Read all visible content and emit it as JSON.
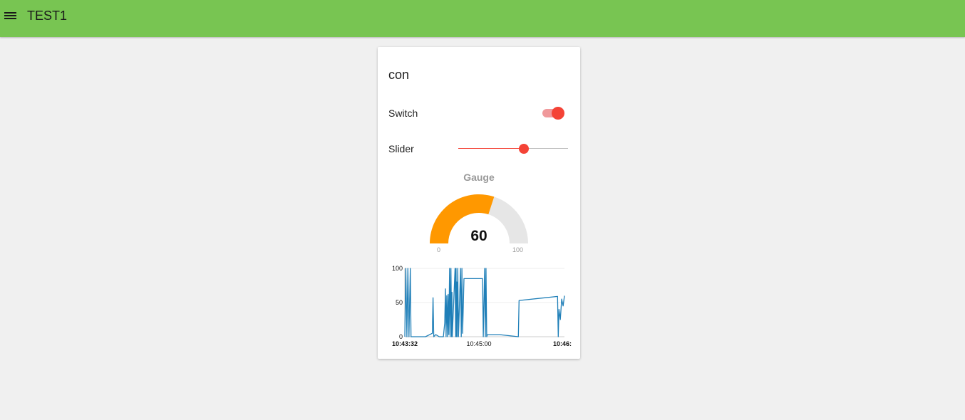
{
  "app": {
    "title": "TEST1"
  },
  "icons": {
    "menu": "menu-icon"
  },
  "colors": {
    "header": "#78c552",
    "accent": "#f44336",
    "gauge_fill": "#ff9800",
    "gauge_track": "#e6e6e6",
    "line": "#1f7fb8"
  },
  "group": {
    "title": "con"
  },
  "switch": {
    "label": "Switch",
    "on": true
  },
  "slider": {
    "label": "Slider",
    "min": 0,
    "max": 100,
    "value": 60
  },
  "gauge": {
    "title": "Gauge",
    "value": 60,
    "display_value": "60",
    "min": 0,
    "max": 100,
    "min_label": "0",
    "max_label": "100"
  },
  "chart_data": {
    "type": "line",
    "title": "",
    "xlabel": "",
    "ylabel": "",
    "ylim": [
      0,
      100
    ],
    "y_ticks": [
      "0",
      "50",
      "100"
    ],
    "x_tick_labels": [
      "10:43:32",
      "10:45:00",
      "10:46:"
    ],
    "grid": true,
    "series": [
      {
        "points": [
          [
            0,
            0
          ],
          [
            1.5,
            100
          ],
          [
            3,
            0
          ],
          [
            4.5,
            100
          ],
          [
            6,
            0
          ],
          [
            8,
            100
          ],
          [
            9,
            0
          ],
          [
            30,
            0
          ],
          [
            40,
            5
          ],
          [
            41,
            57
          ],
          [
            42,
            0
          ],
          [
            45,
            3
          ],
          [
            50,
            0
          ],
          [
            56,
            0
          ],
          [
            58,
            20
          ],
          [
            59,
            70
          ],
          [
            60,
            0
          ],
          [
            61,
            60
          ],
          [
            62,
            0
          ],
          [
            63,
            62
          ],
          [
            64,
            3
          ],
          [
            65,
            100
          ],
          [
            66,
            0
          ],
          [
            67,
            100
          ],
          [
            68,
            0
          ],
          [
            68.5,
            65
          ],
          [
            69,
            0
          ],
          [
            73,
            100
          ],
          [
            74,
            0
          ],
          [
            74.5,
            100
          ],
          [
            75,
            0
          ],
          [
            75.5,
            80
          ],
          [
            76,
            0
          ],
          [
            77,
            100
          ],
          [
            78,
            0
          ],
          [
            81,
            100
          ],
          [
            82,
            0
          ],
          [
            83,
            100
          ],
          [
            84,
            5
          ],
          [
            86,
            85
          ],
          [
            113,
            85
          ],
          [
            114,
            0
          ],
          [
            116,
            100
          ],
          [
            117,
            0
          ],
          [
            118,
            100
          ],
          [
            119,
            0
          ],
          [
            120,
            3
          ],
          [
            138,
            3
          ],
          [
            165,
            0
          ],
          [
            166,
            53
          ],
          [
            222,
            59
          ],
          [
            223,
            0
          ],
          [
            224,
            40
          ],
          [
            226,
            25
          ],
          [
            228,
            55
          ],
          [
            230,
            45
          ],
          [
            232,
            60
          ]
        ]
      }
    ]
  }
}
